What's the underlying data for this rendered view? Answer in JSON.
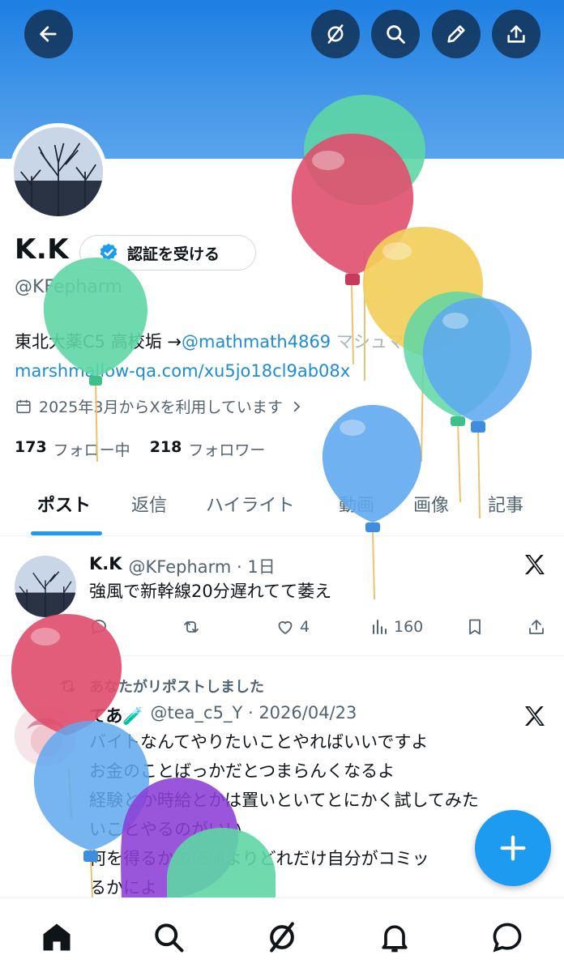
{
  "profile": {
    "name": "K.K",
    "verify_label": "認証を受ける",
    "handle": "@KFepharm",
    "bio_line1_prefix": "東北大薬C5 高校垢 →",
    "bio_line1_link": "@mathmath4869",
    "bio_line1_tail": " マシュマロ→",
    "bio_line2_link": "marshmallow-qa.com/xu5jo18cl9ab08x",
    "joined": "2025年3月からXを利用しています",
    "following_count": "173",
    "following_label": "フォロー中",
    "followers_count": "218",
    "followers_label": "フォロワー"
  },
  "tabs": [
    "ポスト",
    "返信",
    "ハイライト",
    "動画",
    "画像",
    "記事"
  ],
  "posts": [
    {
      "name": "K.K",
      "meta": "@KFepharm · 1日",
      "lines": [
        "強風で新幹線20分遅れてて萎え"
      ],
      "replies": "",
      "reposts": "",
      "likes": "4",
      "views": "160"
    },
    {
      "repost_note": "あなたがリポストしました",
      "name": "てあ🧪",
      "meta": "@tea_c5_Y · 2026/04/23",
      "lines": [
        "バイトなんてやりたいことやればいいですよ",
        "お金のことばっかだとつまらんくなるよ",
        "経験とか時給とかは置いといてとにかく試してみた",
        "いことやるのがいい",
        "何を得るかの価値よりどれだけ自分がコミッ",
        "るかによ"
      ]
    }
  ],
  "colors": {
    "accent": "#1d9bf0",
    "banner": "#2f89e6",
    "balloon_green": "#5ed6a4",
    "balloon_red": "#e04f6e",
    "balloon_yellow": "#f2cf5a",
    "balloon_blue": "#5fa8ef",
    "balloon_purple": "#8c3fd6"
  },
  "icons": {
    "header": [
      "back-arrow-icon",
      "grok-icon",
      "search-icon",
      "edit-icon",
      "share-icon"
    ],
    "nav": [
      "home-icon",
      "search-icon",
      "grok-icon",
      "bell-icon",
      "message-icon"
    ]
  }
}
